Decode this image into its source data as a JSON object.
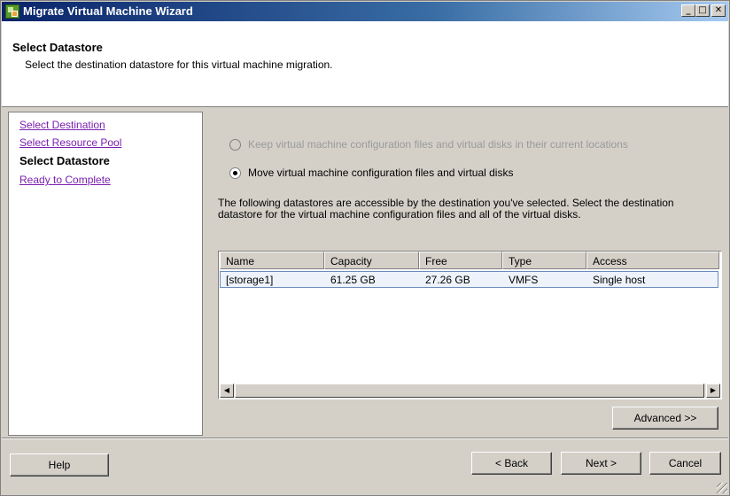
{
  "window": {
    "title": "Migrate Virtual Machine Wizard",
    "controls": {
      "minimize": "_",
      "maximize": "□",
      "close": "✕"
    }
  },
  "header": {
    "title": "Select Datastore",
    "subtitle": "Select the destination datastore for this virtual machine migration."
  },
  "steps": [
    {
      "label": "Select Destination",
      "state": "link"
    },
    {
      "label": "Select Resource Pool",
      "state": "link"
    },
    {
      "label": "Select Datastore",
      "state": "current"
    },
    {
      "label": "Ready to Complete",
      "state": "link"
    }
  ],
  "options": {
    "keep_label": "Keep virtual machine configuration files and virtual disks in their current locations",
    "keep_checked": false,
    "keep_enabled": false,
    "move_label": "Move virtual machine configuration files and virtual disks",
    "move_checked": true
  },
  "description": "The following datastores are accessible by the destination you've selected. Select the destination datastore for the virtual machine configuration files and all of the virtual disks.",
  "table": {
    "columns": [
      "Name",
      "Capacity",
      "Free",
      "Type",
      "Access"
    ],
    "rows": [
      [
        "[storage1]",
        "61.25 GB",
        "27.26 GB",
        "VMFS",
        "Single host"
      ]
    ]
  },
  "buttons": {
    "advanced": "Advanced >>",
    "help": "Help",
    "back": "< Back",
    "next": "Next >",
    "cancel": "Cancel"
  },
  "colors": {
    "titlebar_start": "#0a246a",
    "titlebar_end": "#a6caf0",
    "link": "#7a1fb0",
    "window_bg": "#d4d0c8"
  }
}
